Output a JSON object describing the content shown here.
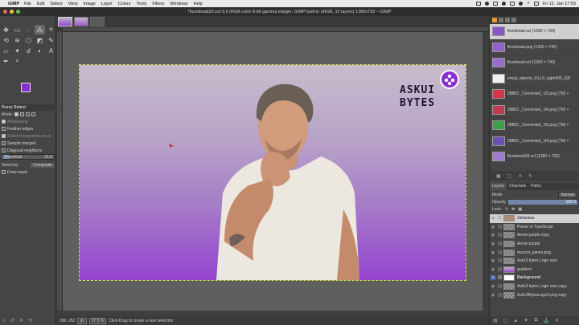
{
  "menubar": {
    "app_name": "GIMP",
    "items": [
      "File",
      "Edit",
      "Select",
      "View",
      "Image",
      "Layer",
      "Colors",
      "Tools",
      "Filters",
      "Windows",
      "Help"
    ],
    "clock": "Fri 12. Jan  17:53"
  },
  "window": {
    "title": "*thumbnail20.xcf-3.0 (RGB color 8-bit gamma integer, GIMP built-in sRGB, 10 layers) 1280x720 – GIMP"
  },
  "tool_options": {
    "title": "Fuzzy Select",
    "mode_label": "Mode:",
    "antialiasing": "Antialiasing",
    "feather_edges": "Feather edges",
    "select_transparent": "Select transparent areas",
    "sample_merged": "Sample merged",
    "diagonal_neighbors": "Diagonal neighbors",
    "threshold_label": "Threshold",
    "threshold_value": "31.9",
    "threshold_fraction": 0.125,
    "select_by_label": "Select by",
    "select_by_value": "Composite",
    "draw_mask": "Draw mask"
  },
  "image": {
    "logo_line1": "ASKUI",
    "logo_line2": "BYTES"
  },
  "status": {
    "coords": "390, 262",
    "unit": "px",
    "zoom": "37.5 %",
    "message": "Click-Drag to create a new selection"
  },
  "images_panel": [
    {
      "name": "thumbnail.xcf (1280 × 720)",
      "color": "#8a55c6"
    },
    {
      "name": "thumbnail.png (1300 × 740)",
      "color": "#9461cc"
    },
    {
      "name": "thumbnail.xcf (1300 × 740)",
      "color": "#9b6bd0"
    },
    {
      "name": "emoji_objects_FILL0_wght400_GR",
      "color": "#f0f0f0"
    },
    {
      "name": "28863 _Converted_-03.png (750 ×",
      "color": "#d8344a"
    },
    {
      "name": "28863 _Converted_-06.png (750 ×",
      "color": "#c03a52"
    },
    {
      "name": "28863 _Converted_-05.png (750 ×",
      "color": "#3aa04c"
    },
    {
      "name": "28863 _Converted_-04.png (750 ×",
      "color": "#6a4fb4"
    },
    {
      "name": "thumbnail18.xcf (1280 × 720)",
      "color": "#a07ad0"
    }
  ],
  "layers_panel": {
    "tabs": [
      "Layers",
      "Channels",
      "Paths"
    ],
    "mode_label": "Mode",
    "mode_value": "Normal",
    "opacity_label": "Opacity",
    "opacity_value": "100.0",
    "opacity_fraction": 1.0,
    "lock_label": "Lock:",
    "layers": [
      {
        "name": "Johannes",
        "thumb": "photo",
        "selected": true
      },
      {
        "name": "Power of TypeScript",
        "thumb": "checker"
      },
      {
        "name": "Arrow purple copy",
        "thumb": "checker"
      },
      {
        "name": "Arrow purple",
        "thumb": "checker"
      },
      {
        "name": "mascot_james.png",
        "thumb": "checker"
      },
      {
        "name": "AskUI bytes Logo new",
        "thumb": "checker"
      },
      {
        "name": "gradient",
        "thumb": "grad"
      },
      {
        "name": "Background",
        "thumb": "white",
        "bold": true,
        "marked": true
      },
      {
        "name": "AskUI bytes Logo new copy",
        "thumb": "checker"
      },
      {
        "name": "AskUIBytesLogo2.png copy",
        "thumb": "checker"
      }
    ]
  },
  "colors": {
    "foreground": "#8a2ed0",
    "background": "#ffffff",
    "selection_outline": "#e3dc5a"
  }
}
